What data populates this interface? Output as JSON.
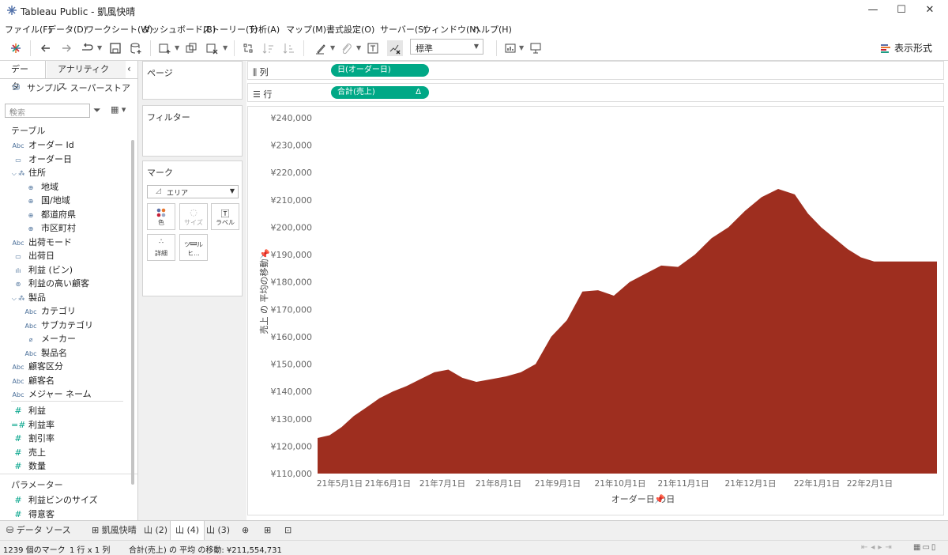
{
  "window": {
    "title": "Tableau Public - 凱風快晴",
    "minimize": "—",
    "maximize": "☐",
    "close": "✕"
  },
  "menu": [
    "ファイル(F)",
    "データ(D)",
    "ワークシート(W)",
    "ダッシュボード(B)",
    "ストーリー(T)",
    "分析(A)",
    "マップ(M)",
    "書式設定(O)",
    "サーバー(S)",
    "ウィンドウ(N)",
    "ヘルプ(H)"
  ],
  "toolbar": {
    "fit_select": "標準",
    "show_me": "表示形式"
  },
  "left_panel": {
    "tabs": [
      "データ",
      "アナリティクス"
    ],
    "collapse": "‹",
    "datasource": "サンプル - スーパーストア",
    "search_placeholder": "検索",
    "tables_header": "テーブル",
    "fields": [
      {
        "icon": "Abc",
        "label": "オーダー Id"
      },
      {
        "icon": "▭",
        "label": "オーダー日"
      },
      {
        "icon": "⌵ ⁂",
        "label": "住所"
      },
      {
        "icon": "⊕",
        "label": "地域"
      },
      {
        "icon": "⊕",
        "label": "国/地域"
      },
      {
        "icon": "⊕",
        "label": "都道府県"
      },
      {
        "icon": "⊕",
        "label": "市区町村"
      },
      {
        "icon": "Abc",
        "label": "出荷モード"
      },
      {
        "icon": "▭",
        "label": "出荷日"
      },
      {
        "icon": "ılı",
        "label": "利益 (ビン)"
      },
      {
        "icon": "⊚",
        "label": "利益の高い顧客"
      },
      {
        "icon": "⌵ ⁂",
        "label": "製品"
      },
      {
        "icon": "Abc",
        "label": "カテゴリ"
      },
      {
        "icon": "Abc",
        "label": "サブカテゴリ"
      },
      {
        "icon": "⌀",
        "label": "メーカー"
      },
      {
        "icon": "Abc",
        "label": "製品名"
      },
      {
        "icon": "Abc",
        "label": "顧客区分"
      },
      {
        "icon": "Abc",
        "label": "顧客名"
      },
      {
        "icon": "Abc",
        "label": "メジャー ネーム"
      }
    ],
    "measures": [
      {
        "icon": "#",
        "label": "利益"
      },
      {
        "icon": "=#",
        "label": "利益率"
      },
      {
        "icon": "#",
        "label": "割引率"
      },
      {
        "icon": "#",
        "label": "売上"
      },
      {
        "icon": "#",
        "label": "数量"
      }
    ],
    "params_header": "パラメーター",
    "params": [
      {
        "icon": "#",
        "label": "利益ビンのサイズ"
      },
      {
        "icon": "#",
        "label": "得意客"
      }
    ]
  },
  "cards": {
    "pages": "ページ",
    "filters": "フィルター",
    "marks": "マーク",
    "mark_type": "エリア",
    "mark_buttons": [
      "色",
      "サイズ",
      "ラベル",
      "詳細",
      "ツールヒ..."
    ]
  },
  "shelves": {
    "columns_label": "列",
    "columns_pill": "日(オーダー日)",
    "rows_label": "行",
    "rows_pill": "合計(売上)",
    "rows_pill_delta": "Δ"
  },
  "chart_data": {
    "type": "area",
    "color": "#9e2e1f",
    "xlabel": "オーダー日 の日",
    "ylabel": "売上 の 平均の移動",
    "ylim": [
      110000,
      240000
    ],
    "y_ticks": [
      "¥110,000",
      "¥120,000",
      "¥130,000",
      "¥140,000",
      "¥150,000",
      "¥160,000",
      "¥170,000",
      "¥180,000",
      "¥190,000",
      "¥200,000",
      "¥210,000",
      "¥220,000",
      "¥230,000",
      "¥240,000"
    ],
    "x_ticks": [
      "21年5月1日",
      "21年6月1日",
      "21年7月1日",
      "21年8月1日",
      "21年9月1日",
      "21年10月1日",
      "21年11月1日",
      "21年12月1日",
      "22年1月1日",
      "22年2月1日"
    ],
    "series": [
      {
        "x_tick_index": [
          0,
          0.25,
          0.5,
          0.75,
          1,
          1.25,
          1.5,
          1.75,
          2,
          2.25,
          2.5,
          2.75,
          3,
          3.25,
          3.5,
          3.75,
          4,
          4.25,
          4.5,
          4.75,
          5,
          5.25,
          5.5,
          5.75,
          6,
          6.25,
          6.5,
          6.75,
          7,
          7.25,
          7.5,
          7.75,
          8,
          8.25,
          8.5,
          8.75,
          9,
          9.25,
          9.5
        ],
        "values": [
          123000,
          124000,
          127000,
          131000,
          134000,
          137500,
          140000,
          142000,
          144500,
          147000,
          148000,
          145000,
          143500,
          144500,
          145500,
          147000,
          150000,
          160000,
          166000,
          176500,
          177000,
          175000,
          180000,
          183000,
          186000,
          185500,
          190000,
          196000,
          200000,
          206000,
          211000,
          214000,
          212000,
          205000,
          200000,
          196000,
          192000,
          189000,
          187500
        ]
      }
    ]
  },
  "bottom_tabs": [
    "データ ソース",
    "凱風快晴",
    "山 (2)",
    "山 (4)",
    "山 (3)"
  ],
  "status": {
    "marks": "1239 個のマーク",
    "rows_cols": "1 行 x 1 列",
    "summary": "合計(売上) の 平均 の移動: ¥211,554,731"
  }
}
